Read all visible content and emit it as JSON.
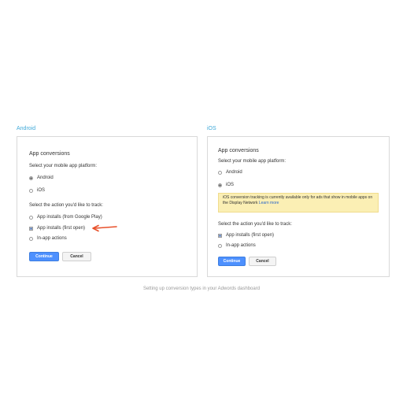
{
  "android": {
    "section_title": "Android",
    "panel_title": "App conversions",
    "platform_prompt": "Select your mobile app platform:",
    "platforms": [
      "Android",
      "iOS"
    ],
    "selected_platform": "Android",
    "action_prompt": "Select the action you'd like to track:",
    "actions": [
      "App installs (from Google Play)",
      "App installs (first open)",
      "In-app actions"
    ],
    "selected_action": "App installs (first open)",
    "continue_label": "Continue",
    "cancel_label": "Cancel",
    "arrow_color": "#e8502a"
  },
  "ios": {
    "section_title": "iOS",
    "panel_title": "App conversions",
    "platform_prompt": "Select your mobile app platform:",
    "platforms": [
      "Android",
      "iOS"
    ],
    "selected_platform": "iOS",
    "notice_text": "iOS conversion tracking is currently available only for ads that show in mobile apps on the Display Network",
    "notice_link": "Learn more",
    "action_prompt": "Select the action you'd like to track:",
    "actions": [
      "App installs (first open)",
      "In-app actions"
    ],
    "selected_action": "App installs (first open)",
    "continue_label": "Continue",
    "cancel_label": "Cancel"
  },
  "caption": "Setting up conversion types in your Adwords dashboard",
  "colors": {
    "accent_blue": "#4d90fe",
    "section_title": "#3fa9d8",
    "notice_bg": "#fbefb4"
  }
}
